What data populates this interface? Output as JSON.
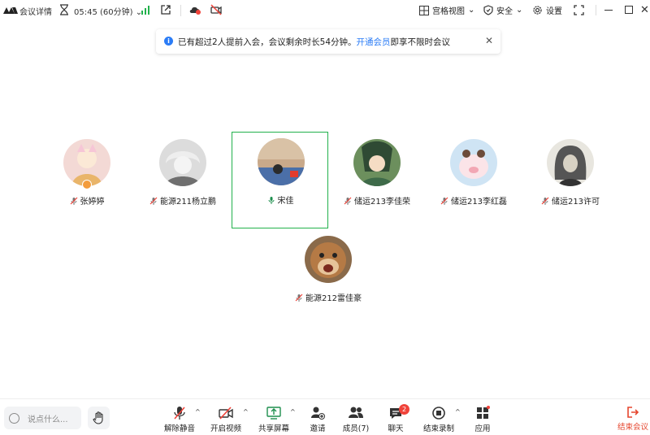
{
  "topbar": {
    "meeting_details": "会议详情",
    "timer": "05:45 (60分钟)",
    "grid_view": "宫格视图",
    "security": "安全",
    "settings": "设置"
  },
  "notice": {
    "text_before": "已有超过2人提前入会，会议剩余时长54分钟。",
    "link": "开通会员",
    "text_after": "即享不限时会议"
  },
  "participants": [
    {
      "name": "张婷婷"
    },
    {
      "name": "能源211杨立鹏"
    },
    {
      "name": "宋佳"
    },
    {
      "name": "储运213李佳荣"
    },
    {
      "name": "储运213李红磊"
    },
    {
      "name": "储运213许可"
    },
    {
      "name": "能源212雷佳豪"
    }
  ],
  "bottombar": {
    "chat_placeholder": "说点什么...",
    "unmute": "解除静音",
    "start_video": "开启视频",
    "share_screen": "共享屏幕",
    "invite": "邀请",
    "members": "成员(7)",
    "chat": "聊天",
    "chat_badge": "2",
    "stop_recording": "结束录制",
    "apps": "应用",
    "end_meeting": "结束会议"
  },
  "colors": {
    "accent_blue": "#2b7cf6",
    "active_green": "#22b14c",
    "danger_red": "#e5452d"
  }
}
